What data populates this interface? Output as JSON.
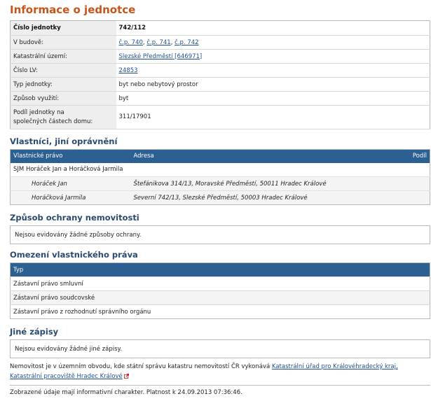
{
  "title": "Informace o jednotce",
  "unit_info": {
    "rows": [
      {
        "label": "Číslo jednotky",
        "value": "742/112"
      },
      {
        "label": "V budově:",
        "links": [
          "č.p. 740",
          "č.p. 741",
          "č.p. 742"
        ]
      },
      {
        "label": "Katastrální území:",
        "link": "Slezské Předměstí [646971]"
      },
      {
        "label": "Číslo LV:",
        "link": "24853"
      },
      {
        "label": "Typ jednotky:",
        "value": "byt nebo nebytový prostor"
      },
      {
        "label": "Způsob využití:",
        "value": "byt"
      },
      {
        "label_line1": "Podíl jednotky na",
        "label_line2": "společných částech domu:",
        "value": "311/17901"
      }
    ]
  },
  "owners": {
    "title": "Vlastníci, jiní oprávnění",
    "headers": {
      "right": "Vlastnické právo",
      "address": "Adresa",
      "share": "Podíl"
    },
    "group": "SJM Horáček Jan a Horáčková Jarmila",
    "members": [
      {
        "name": "Horáček Jan",
        "address": "Štefánikova 314/13, Moravské Předměstí, 50011 Hradec Králové"
      },
      {
        "name": "Horáčková Jarmila",
        "address": "Severní 742/13, Slezské Předměstí, 50003 Hradec Králové"
      }
    ]
  },
  "protection": {
    "title": "Způsob ochrany nemovitosti",
    "text": "Nejsou evidovány žádné způsoby ochrany."
  },
  "restrictions": {
    "title": "Omezení vlastnického práva",
    "header": "Typ",
    "items": [
      "Zástavní právo smluvní",
      "Zástavní právo soudcovské",
      "Zástavní právo z rozhodnutí správního orgánu"
    ]
  },
  "other": {
    "title": "Jiné zápisy",
    "text": "Nejsou evidovány žádné jiné zápisy."
  },
  "note": {
    "text": "Nemovitost je v územním obvodu, kde státní správu katastru nemovitostí ČR vykonává",
    "link1": "Katastrální úřad pro Královéhradecký kraj,",
    "link2": "Katastrální pracoviště Hradec Králové"
  },
  "footer": "Zobrazené údaje mají informativní charakter. Platnost k 24.09.2013 07:36:46.",
  "colors": {
    "title": "#c8541a",
    "section": "#2b4a6f",
    "header_bg": "#2c5f92",
    "link": "#1d4f91",
    "external_icon": "#d0282a"
  },
  "icons": {
    "external_link": "external-link-icon"
  }
}
